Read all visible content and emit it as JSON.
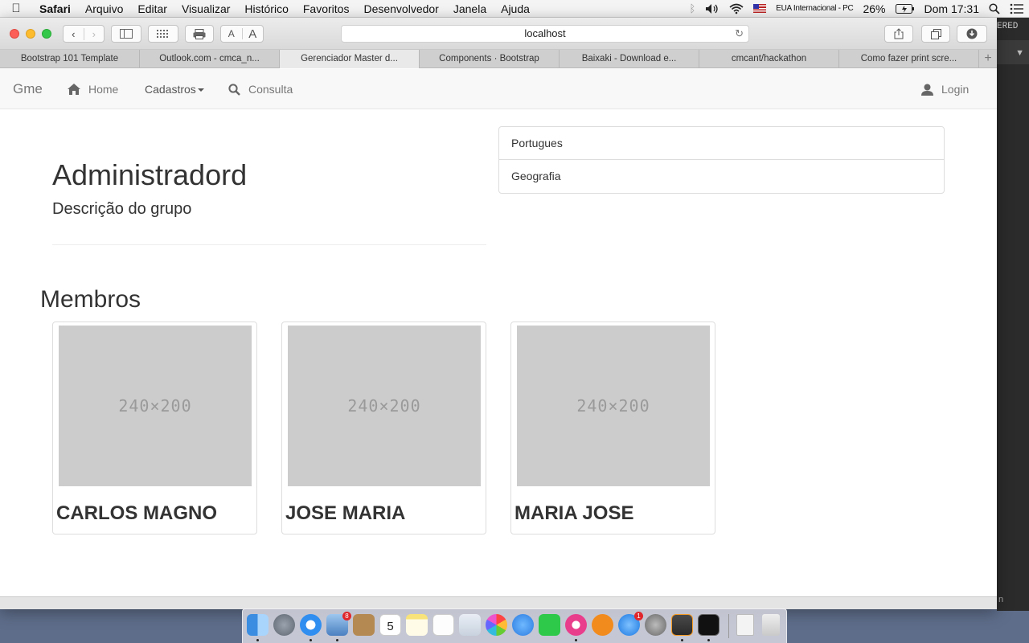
{
  "menubar": {
    "apple": "",
    "items": [
      "Safari",
      "Arquivo",
      "Editar",
      "Visualizar",
      "Histórico",
      "Favoritos",
      "Desenvolvedor",
      "Janela",
      "Ajuda"
    ],
    "input_source": "EUA Internacional - PC",
    "battery": "26%",
    "clock": "Dom 17:31"
  },
  "background_app": {
    "tag": "ERED",
    "bottom_text": "n"
  },
  "browser": {
    "address": "localhost",
    "font_small": "A",
    "font_large": "A",
    "tabs": [
      "Bootstrap 101 Template",
      "Outlook.com - cmca_n...",
      "Gerenciador Master d...",
      "Components · Bootstrap",
      "Baixaki - Download e...",
      "cmcant/hackathon",
      "Como fazer print scre..."
    ],
    "active_tab_index": 2,
    "new_tab": "+"
  },
  "navbar": {
    "brand": "Gme",
    "home": "Home",
    "cadastros": "Cadastros",
    "consulta": "Consulta",
    "login": "Login"
  },
  "group": {
    "title": "Administradord",
    "description": "Descrição do grupo",
    "subjects": [
      "Portugues",
      "Geografia"
    ]
  },
  "members": {
    "heading": "Membros",
    "placeholder_text": "240×200",
    "items": [
      "CARLOS MAGNO",
      "JOSE MARIA",
      "MARIA JOSE"
    ]
  },
  "dock": {
    "calendar_day": "5",
    "badges": {
      "mail": "8",
      "appstore": "1"
    }
  }
}
